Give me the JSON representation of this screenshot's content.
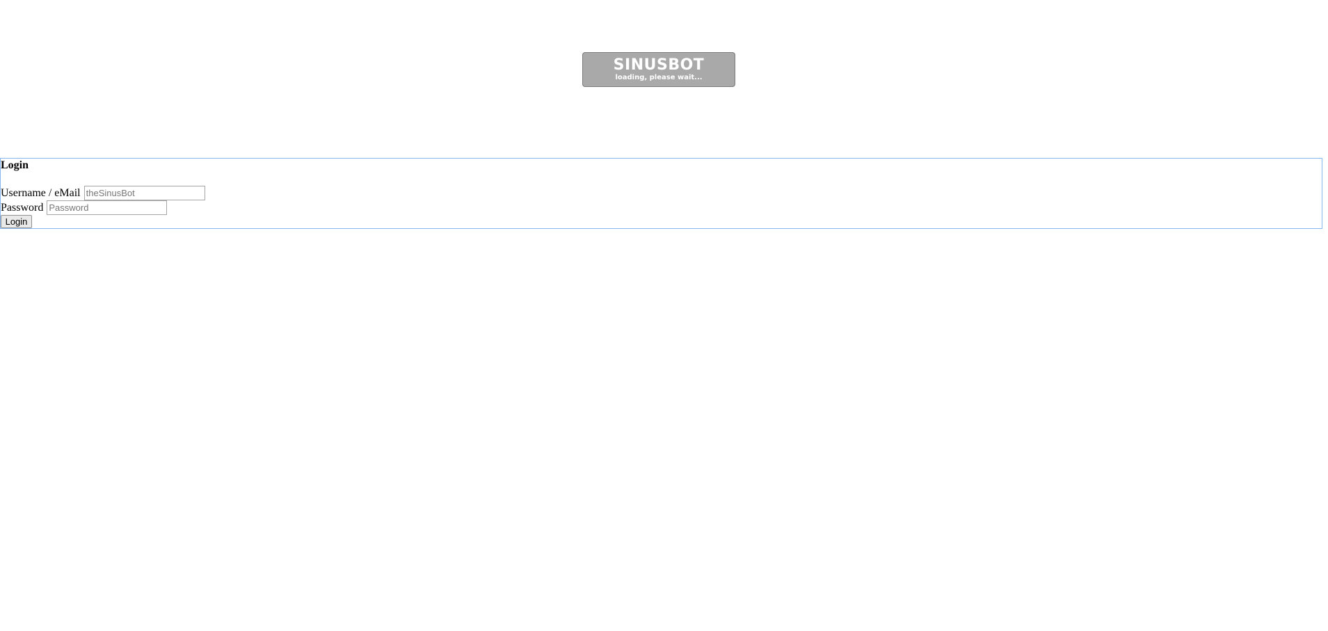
{
  "loader": {
    "logo_text": "SINUSBOT",
    "status_text": "loading, please wait..."
  },
  "login": {
    "title": "Login",
    "username_label": "Username / eMail",
    "username_placeholder": "theSinusBot",
    "password_label": "Password",
    "password_placeholder": "Password",
    "submit_label": "Login"
  },
  "colors": {
    "loader_bg": "#a9a9a9",
    "form_border": "#86b6f0"
  }
}
